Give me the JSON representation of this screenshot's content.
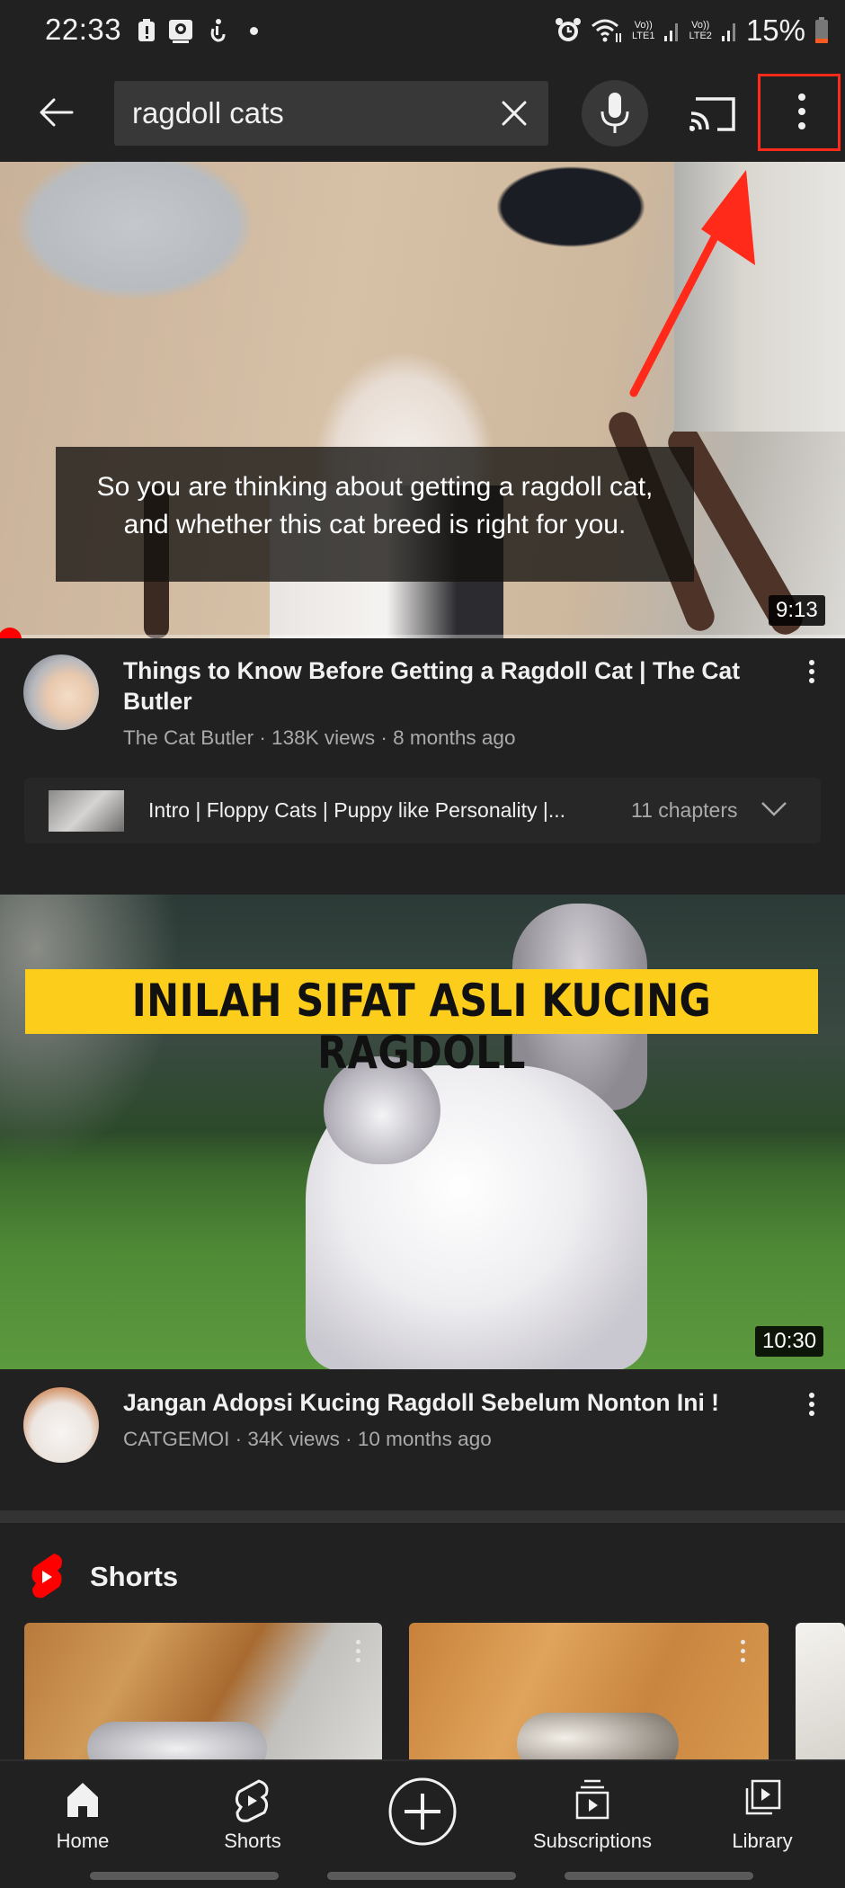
{
  "status_bar": {
    "time": "22:33",
    "battery_percent": "15%",
    "network_labels": [
      "LTE1",
      "LTE2"
    ],
    "left_icons": [
      "battery-alert-icon",
      "gallery-icon",
      "accessibility-icon",
      "dot-icon"
    ],
    "right_icons": [
      "alarm-icon",
      "wifi-icon",
      "signal-lte1-icon",
      "signal-lte2-icon",
      "battery-icon"
    ]
  },
  "top_bar": {
    "search_value": "ragdoll cats",
    "icons": [
      "back-arrow-icon",
      "clear-icon",
      "microphone-icon",
      "cast-icon",
      "more-vert-icon"
    ],
    "highlight_color": "#ff2a1a"
  },
  "videos": [
    {
      "caption_lines": [
        "So you are thinking about getting a ragdoll cat,",
        "and whether this cat breed is right for you."
      ],
      "duration": "9:13",
      "watch_progress_percent": 0,
      "title": "Things to Know Before Getting a Ragdoll Cat | The Cat Butler",
      "meta": "The Cat Butler · 138K views · 8 months ago",
      "chapters": {
        "text": "Intro | Floppy Cats | Puppy like Personality |...",
        "count": "11 chapters"
      }
    },
    {
      "banner_text": "INILAH SIFAT ASLI KUCING RAGDOLL",
      "duration": "10:30",
      "title": "Jangan Adopsi Kucing Ragdoll Sebelum Nonton Ini !",
      "meta": "CATGEMOI · 34K views · 10 months ago"
    }
  ],
  "shorts": {
    "title": "Shorts"
  },
  "bottom_nav": {
    "items": [
      {
        "label": "Home",
        "icon": "home-icon"
      },
      {
        "label": "Shorts",
        "icon": "shorts-icon"
      },
      {
        "label": "",
        "icon": "create-icon"
      },
      {
        "label": "Subscriptions",
        "icon": "subscriptions-icon"
      },
      {
        "label": "Library",
        "icon": "library-icon"
      }
    ]
  },
  "colors": {
    "background": "#212121",
    "accent_red": "#ff0000",
    "banner_yellow": "#fdcd1c"
  }
}
